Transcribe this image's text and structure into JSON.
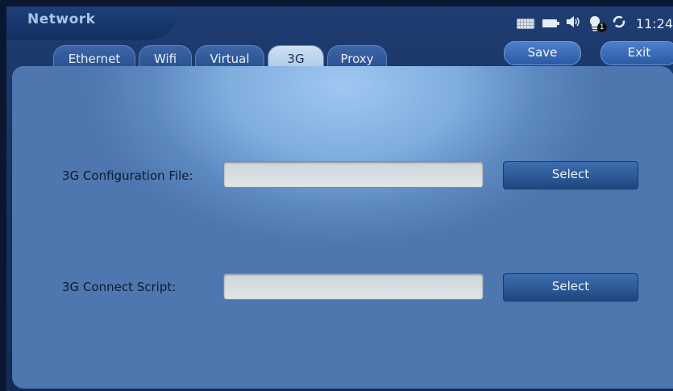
{
  "window": {
    "title": "Network"
  },
  "status_bar": {
    "icons": [
      "keyboard-icon",
      "battery-icon",
      "volume-icon",
      "notification-bulb-icon",
      "sync-icon"
    ],
    "notification_count": "1",
    "time": "11:24"
  },
  "tabs": [
    {
      "label": "Ethernet"
    },
    {
      "label": "Wifi"
    },
    {
      "label": "Virtual"
    },
    {
      "label": "3G",
      "active": true
    },
    {
      "label": "Proxy"
    }
  ],
  "toolbar": {
    "save_label": "Save",
    "exit_label": "Exit"
  },
  "form": {
    "config_file": {
      "label": "3G Configuration File:",
      "value": "",
      "button": "Select"
    },
    "connect_script": {
      "label": "3G Connect Script:",
      "value": "",
      "button": "Select"
    }
  },
  "colors": {
    "accent": "#2c5aa4",
    "panel": "#7fadde",
    "active_tab": "#cfe0f3"
  }
}
